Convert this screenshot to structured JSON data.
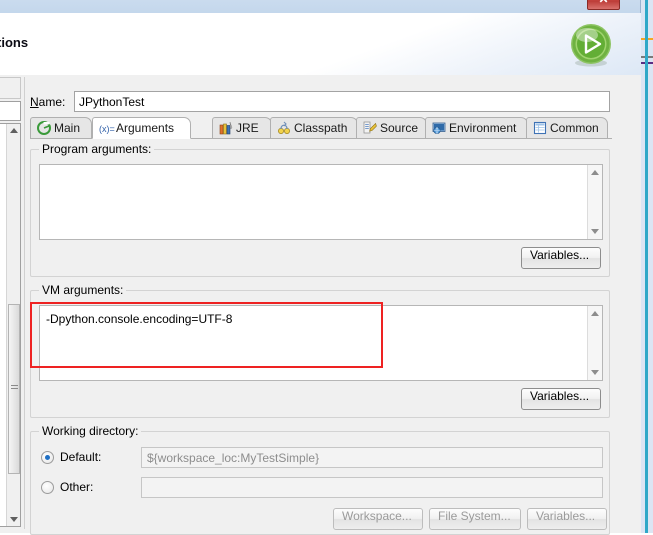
{
  "window": {
    "title": "nfigurations",
    "close_label": "✕"
  },
  "header": {
    "title": "nfigurations",
    "run_icon": "run-play-icon"
  },
  "name_field": {
    "label": "Name:",
    "label_mnemonic": "N",
    "value": "JPythonTest"
  },
  "tabs": [
    {
      "label": "Main",
      "icon": "main-launch-icon",
      "active": false
    },
    {
      "label": "Arguments",
      "icon": "arguments-icon",
      "active": true
    },
    {
      "label": "JRE",
      "icon": "jre-books-icon",
      "active": false
    },
    {
      "label": "Classpath",
      "icon": "classpath-icon",
      "active": false
    },
    {
      "label": "Source",
      "icon": "source-pencil-icon",
      "active": false
    },
    {
      "label": "Environment",
      "icon": "environment-icon",
      "active": false
    },
    {
      "label": "Common",
      "icon": "common-table-icon",
      "active": false
    }
  ],
  "program_arguments": {
    "group_title": "Program arguments:",
    "value": "",
    "variables_button": "Variables..."
  },
  "vm_arguments": {
    "group_title": "VM arguments:",
    "value": "-Dpython.console.encoding=UTF-8",
    "variables_button": "Variables...",
    "highlight_color": "#ee2222"
  },
  "working_directory": {
    "group_title": "Working directory:",
    "default_label": "Default:",
    "default_selected": true,
    "default_value": "${workspace_loc:MyTestSimple}",
    "other_label": "Other:",
    "other_selected": false,
    "other_value": "",
    "buttons": [
      "Workspace...",
      "File System...",
      "Variables..."
    ]
  },
  "colors": {
    "accent_blue": "#1f6fc4",
    "annotation_red": "#ee2222",
    "run_green": "#5fb13a",
    "dialog_bg": "#f0f0f0"
  }
}
